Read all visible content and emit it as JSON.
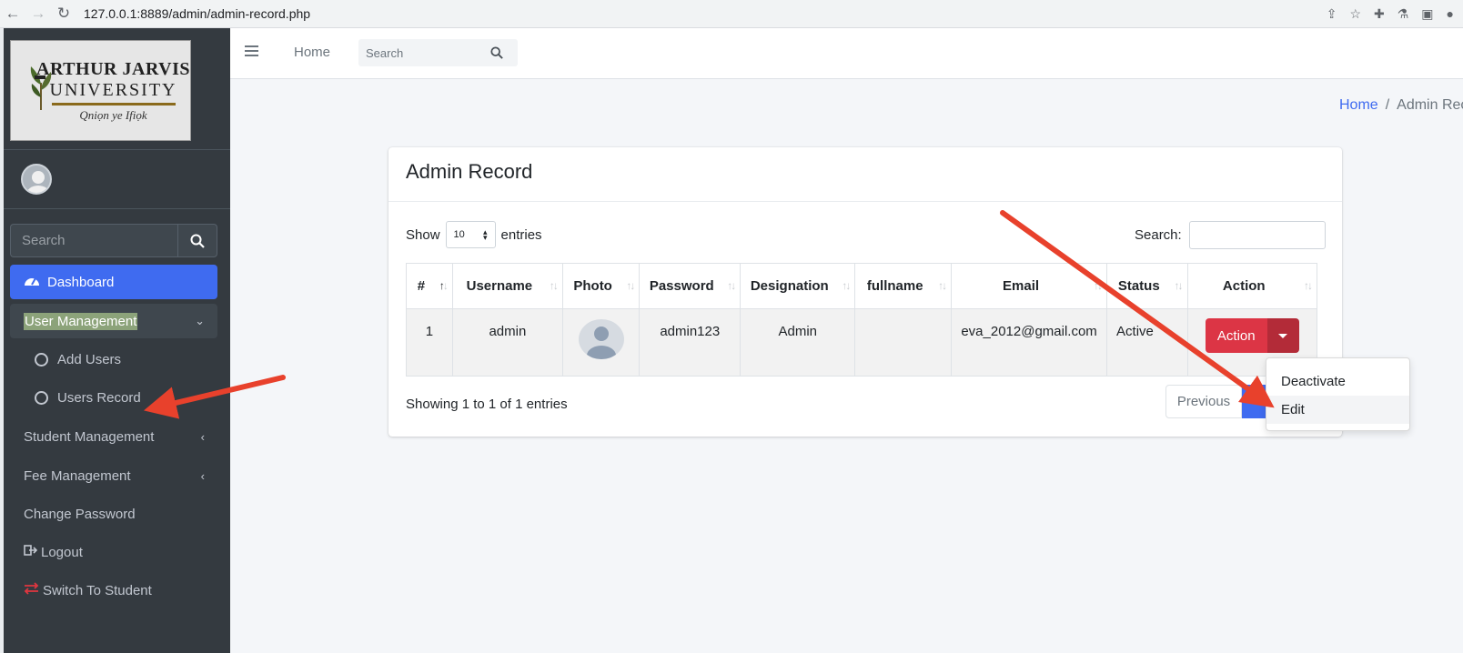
{
  "browser": {
    "url": "127.0.0.1:8889/admin/admin-record.php"
  },
  "logo": {
    "line1": "ARTHUR JARVIS",
    "line2": "UNIVERSITY",
    "motto": "Qniọn ye Ifiọk"
  },
  "sidebar": {
    "search_placeholder": "Search",
    "items": [
      {
        "label": "Dashboard",
        "icon": "tachometer-icon"
      },
      {
        "label": "User Management",
        "icon": "chevron-down-icon"
      },
      {
        "label": "Add Users",
        "icon": "circle-icon"
      },
      {
        "label": "Users Record",
        "icon": "circle-icon"
      },
      {
        "label": "Student Management",
        "icon": "chevron-left-icon"
      },
      {
        "label": "Fee Management",
        "icon": "chevron-left-icon"
      },
      {
        "label": "Change Password"
      },
      {
        "label": "Logout",
        "icon": "sign-out-icon"
      },
      {
        "label": "Switch To Student",
        "icon": "exchange-icon"
      }
    ]
  },
  "topbar": {
    "home_label": "Home",
    "search_placeholder": "Search"
  },
  "breadcrumb": {
    "home": "Home",
    "separator": "/",
    "current": "Admin Rec"
  },
  "card": {
    "title": "Admin Record",
    "show_label": "Show",
    "page_length": "10",
    "entries_label": "entries",
    "search_label": "Search:",
    "columns": [
      "#",
      "Username",
      "Photo",
      "Password",
      "Designation",
      "fullname",
      "Email",
      "Status",
      "Action"
    ],
    "rows": [
      {
        "num": "1",
        "username": "admin",
        "password": "admin123",
        "designation": "Admin",
        "fullname": "",
        "email": "eva_2012@gmail.com",
        "status": "Active",
        "action": "Action"
      }
    ],
    "info": "Showing 1 to 1 of 1 entries",
    "previous": "Previous"
  },
  "action_menu": {
    "items": [
      "Deactivate",
      "Edit"
    ]
  },
  "colors": {
    "sidebar_bg": "#343a40",
    "primary": "#3f6bf0",
    "danger": "#dc3545",
    "annotation_arrow": "#e8412c"
  }
}
